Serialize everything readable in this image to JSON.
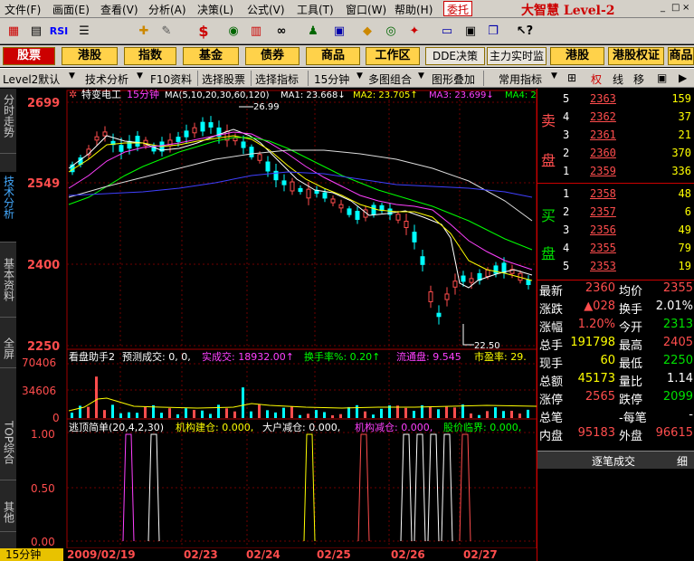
{
  "menubar": {
    "items": [
      "文件(F)",
      "画面(E)",
      "查看(V)",
      "分析(A)",
      "决策(L)",
      "公式(V)",
      "工具(T)",
      "窗口(W)",
      "帮助(H)"
    ],
    "weituo": "委托",
    "brand": "大智慧 Level-2"
  },
  "market_tabs": [
    "股票",
    "港股",
    "指数",
    "基金",
    "债券",
    "商品",
    "工作区",
    "DDE决策",
    "主力实时监",
    "港股",
    "港股权证",
    "商品"
  ],
  "funcbar": {
    "items": [
      "Level2默认",
      "技术分析",
      "F10资料",
      "选择股票",
      "选择指标",
      "15分钟",
      "多图组合",
      "图形叠加",
      "常用指标"
    ],
    "right_icons": [
      "权",
      "线",
      "移"
    ]
  },
  "left_tabs": [
    "分时走势",
    "技术分析",
    "基本资料",
    "全屏",
    "TOP综合",
    "其他"
  ],
  "chart_header": {
    "stock": "特变电工",
    "period": "15分钟",
    "ma_params": "MA(5,10,20,30,60,120)",
    "ma1": "MA1: 23.668↓",
    "ma2": "MA2: 23.705↑",
    "ma3": "MA3: 23.699↓",
    "ma4": "MA4: 2"
  },
  "price_axis": [
    "2699",
    "2549",
    "2400",
    "2250"
  ],
  "annotations": {
    "high": "26.99",
    "low": "22.50"
  },
  "volume_header": {
    "title": "看盘助手2",
    "predict": "预测成交: 0, 0,",
    "actual": "实成交: 18932.00↑",
    "turnover": "换手率%: 0.20↑",
    "float": "流通盘: 9.545",
    "pe": "市盈率: 29."
  },
  "volume_axis": [
    "70406",
    "34606",
    "0"
  ],
  "indicator_header": {
    "title": "逃顶简单(20,4,2,30)",
    "build": "机构建仓: 0.000,",
    "reduce_big": "大户减仓: 0.000,",
    "reduce_inst": "机构减仓: 0.000,",
    "limit": "股价临界: 0.000,"
  },
  "indicator_axis": [
    "1.00",
    "0.50",
    "0.00"
  ],
  "time_axis": [
    "2009/02/19",
    "02/23",
    "02/24",
    "02/25",
    "02/26",
    "02/27"
  ],
  "period_label": "15分钟",
  "orderbook": {
    "sell_label": [
      "卖",
      "盘"
    ],
    "buy_label": [
      "买",
      "盘"
    ],
    "sell": [
      {
        "level": "5",
        "price": "2363",
        "vol": "159"
      },
      {
        "level": "4",
        "price": "2362",
        "vol": "37"
      },
      {
        "level": "3",
        "price": "2361",
        "vol": "21"
      },
      {
        "level": "2",
        "price": "2360",
        "vol": "370"
      },
      {
        "level": "1",
        "price": "2359",
        "vol": "336"
      }
    ],
    "buy": [
      {
        "level": "1",
        "price": "2358",
        "vol": "48"
      },
      {
        "level": "2",
        "price": "2357",
        "vol": "6"
      },
      {
        "level": "3",
        "price": "2356",
        "vol": "49"
      },
      {
        "level": "4",
        "price": "2355",
        "vol": "79"
      },
      {
        "level": "5",
        "price": "2353",
        "vol": "19"
      }
    ]
  },
  "quote": [
    {
      "l1": "最新",
      "v1": "2360",
      "l2": "均价",
      "v2": "2355"
    },
    {
      "l1": "涨跌",
      "v1": "▲028",
      "l2": "换手",
      "v2": "2.01%"
    },
    {
      "l1": "涨幅",
      "v1": "1.20%",
      "l2": "今开",
      "v2": "2313"
    },
    {
      "l1": "总手",
      "v1": "191798",
      "l2": "最高",
      "v2": "2405"
    },
    {
      "l1": "现手",
      "v1": "60",
      "l2": "最低",
      "v2": "2250"
    },
    {
      "l1": "总额",
      "v1": "45173",
      "l2": "量比",
      "v2": "1.14"
    },
    {
      "l1": "涨停",
      "v1": "2565",
      "l2": "跌停",
      "v2": "2099"
    },
    {
      "l1": "总笔",
      "v1": "",
      "l2": "-每笔",
      "v2": "-"
    },
    {
      "l1": "内盘",
      "v1": "95183",
      "l2": "外盘",
      "v2": "96615"
    }
  ],
  "trade_tab": {
    "label": "逐笔成交",
    "short": "细"
  },
  "colors": {
    "up": "#ff4d4d",
    "down": "#00ffff",
    "bg": "#000000",
    "grid": "#8a0000"
  }
}
